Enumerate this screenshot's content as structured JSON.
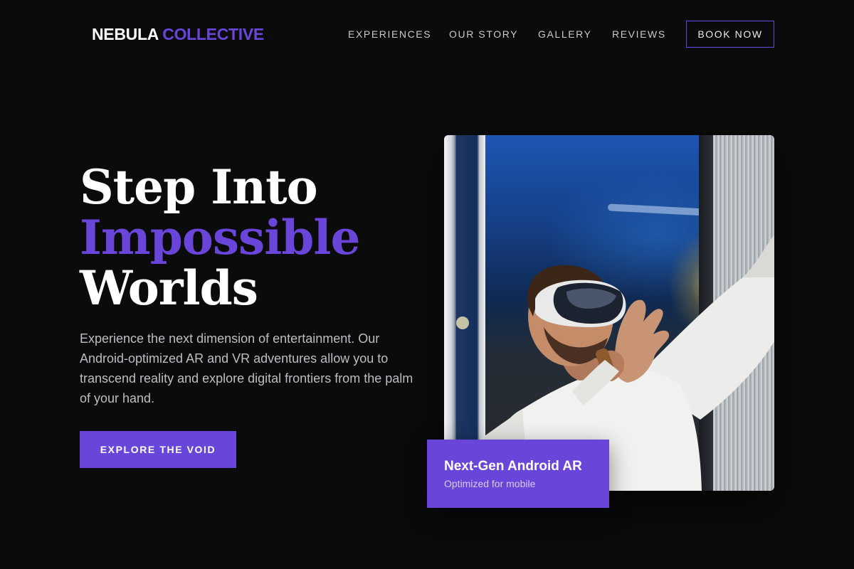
{
  "brand": {
    "name_primary": "NEBULA",
    "name_accent": "COLLECTIVE",
    "accent_color": "#6a45d9"
  },
  "nav": {
    "items": [
      {
        "label": "EXPERIENCES"
      },
      {
        "label": "OUR STORY"
      },
      {
        "label": "GALLERY"
      },
      {
        "label": "REVIEWS"
      }
    ],
    "cta_label": "BOOK NOW"
  },
  "hero": {
    "title_line1": "Step Into",
    "title_line2": "Impossible",
    "title_line3": "Worlds",
    "description": "Experience the next dimension of entertainment. Our Android-optimized AR and VR adventures allow you to transcend reality and explore digital frontiers from the palm of your hand.",
    "cta_label": "EXPLORE THE VOID",
    "image_subject": "man-wearing-vr-headset",
    "badge": {
      "title": "Next-Gen Android AR",
      "subtitle": "Optimized for mobile"
    }
  },
  "colors": {
    "background": "#0b0b0c",
    "accent": "#6a45d9",
    "text": "#ffffff",
    "muted_text": "#bdbdc4"
  }
}
